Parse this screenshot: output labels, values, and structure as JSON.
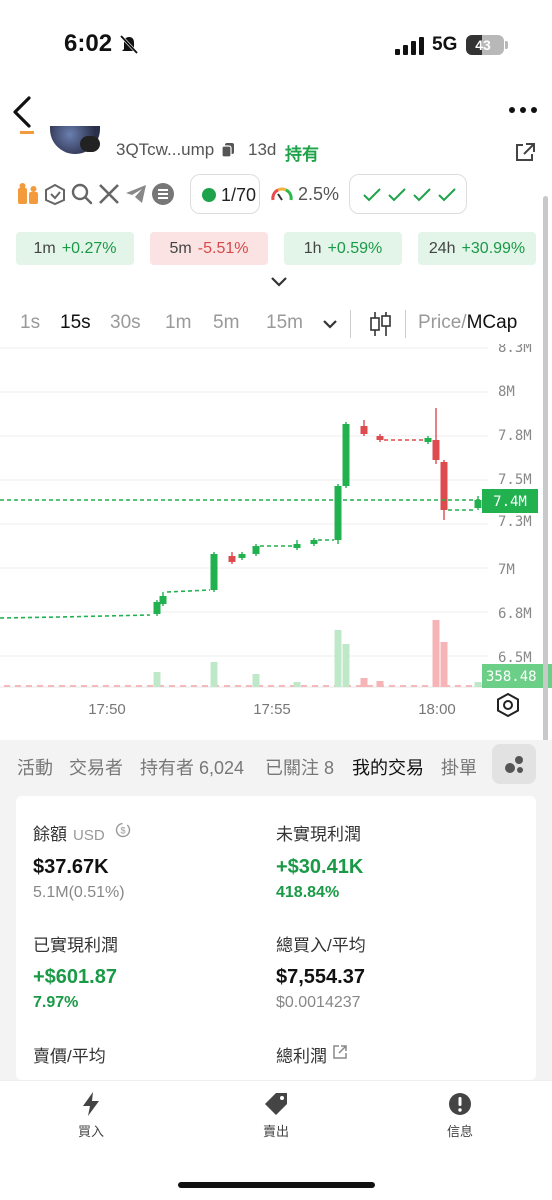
{
  "status_bar": {
    "time": "6:02",
    "network": "5G",
    "battery": "43",
    "battery_level": 0.43
  },
  "token": {
    "address": "3QTcw...ump",
    "age": "13d",
    "holding_label": "持有"
  },
  "social_icons": [
    "community-icon",
    "bundle-icon",
    "search-icon",
    "x-icon",
    "telegram-icon",
    "solana-icon"
  ],
  "holders": {
    "value": "1/70"
  },
  "risk": {
    "value": "2.5%"
  },
  "checks": {
    "count": 4
  },
  "changes": [
    {
      "label": "1m",
      "value": "+0.27%",
      "dir": "up"
    },
    {
      "label": "5m",
      "value": "-5.51%",
      "dir": "down"
    },
    {
      "label": "1h",
      "value": "+0.59%",
      "dir": "up"
    },
    {
      "label": "24h",
      "value": "+30.99%",
      "dir": "up"
    }
  ],
  "intervals": {
    "items": [
      "1s",
      "15s",
      "30s",
      "1m",
      "5m",
      "15m"
    ],
    "active": "15s",
    "price_label": "Price",
    "sep": "/",
    "mcap_label": "MCap"
  },
  "chart_data": {
    "type": "candlestick",
    "y_ticks": [
      "8.3M",
      "8M",
      "7.8M",
      "7.5M",
      "7.3M",
      "7M",
      "6.8M",
      "6.5M"
    ],
    "x_ticks": [
      "17:50",
      "17:55",
      "18:00"
    ],
    "current_price_label": "7.4M",
    "volume_label": "358.48",
    "colors": {
      "up": "#21b14f",
      "down": "#dd4b4f",
      "grid": "#ececec"
    }
  },
  "tabs": {
    "items": [
      "活動",
      "交易者",
      "持有者 6,024",
      "已關注 8",
      "我的交易",
      "掛單"
    ],
    "active": "我的交易"
  },
  "stats": {
    "balance": {
      "label": "餘額",
      "unit": "USD",
      "value": "$37.67K",
      "sub": "5.1M(0.51%)"
    },
    "unrealized": {
      "label": "未實現利潤",
      "value": "+$30.41K",
      "sub": "418.84%"
    },
    "realized": {
      "label": "已實現利潤",
      "value": "+$601.87",
      "sub": "7.97%"
    },
    "total_buy": {
      "label": "總買入/平均",
      "value": "$7,554.37",
      "sub": "$0.0014237"
    },
    "sell_avg": {
      "label": "賣價/平均"
    },
    "total_profit": {
      "label": "總利潤"
    }
  },
  "bottom_bar": {
    "buy": "買入",
    "sell": "賣出",
    "info": "信息"
  }
}
